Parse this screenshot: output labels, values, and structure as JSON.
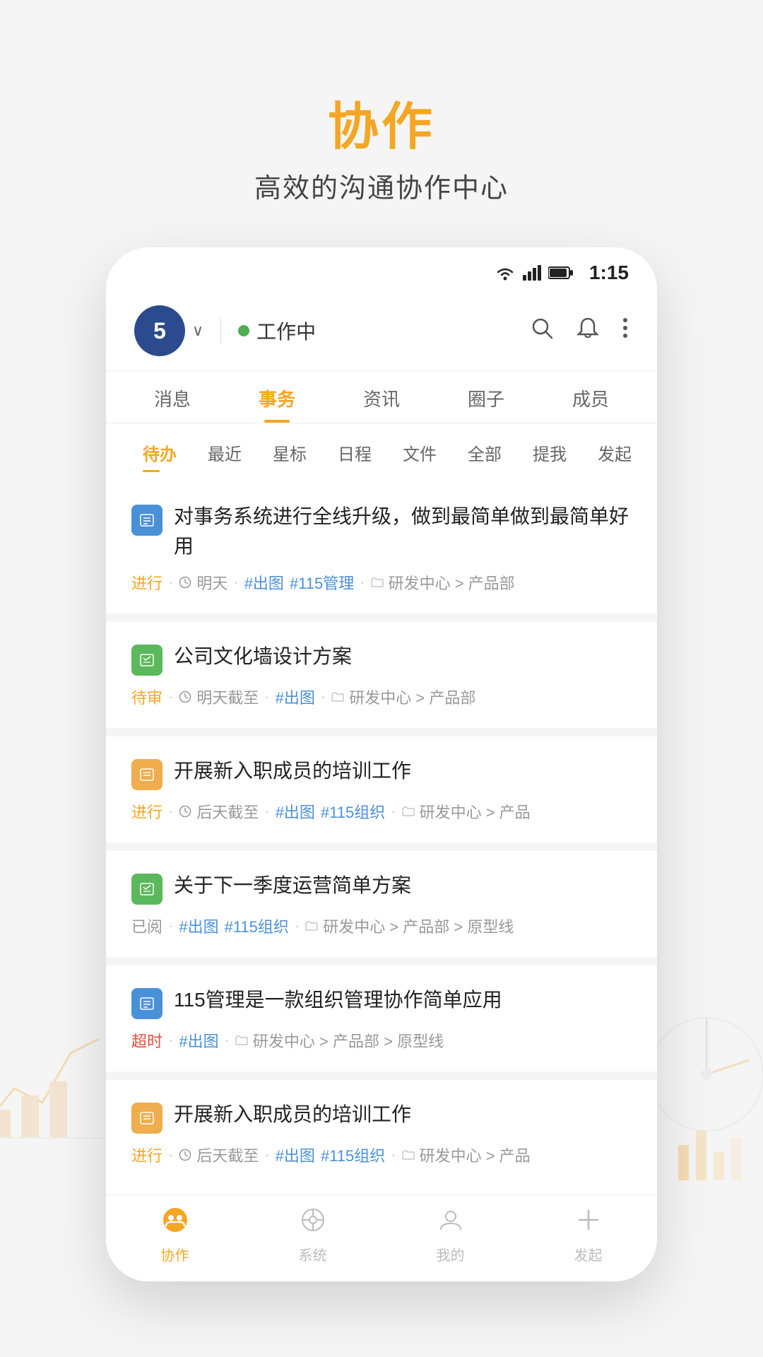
{
  "header": {
    "title": "协作",
    "subtitle": "高效的沟通协作中心"
  },
  "status_bar": {
    "time": "1:15"
  },
  "app_header": {
    "avatar_number": "5",
    "status_label": "工作中",
    "dropdown_char": "∨"
  },
  "nav_tabs": [
    {
      "label": "消息",
      "active": false
    },
    {
      "label": "事务",
      "active": true
    },
    {
      "label": "资讯",
      "active": false
    },
    {
      "label": "圈子",
      "active": false
    },
    {
      "label": "成员",
      "active": false
    }
  ],
  "filter_items": [
    {
      "label": "待办",
      "active": true
    },
    {
      "label": "最近",
      "active": false
    },
    {
      "label": "星标",
      "active": false
    },
    {
      "label": "日程",
      "active": false
    },
    {
      "label": "文件",
      "active": false
    },
    {
      "label": "全部",
      "active": false
    },
    {
      "label": "提我",
      "active": false
    },
    {
      "label": "发起",
      "active": false
    }
  ],
  "tasks": [
    {
      "id": 1,
      "icon_type": "blue",
      "icon_char": "≡",
      "title": "对事务系统进行全线升级，做到最简单做到最简单好用",
      "status": "进行",
      "status_type": "active",
      "deadline": "明天",
      "tags": [
        "#出图",
        "#115管理"
      ],
      "path": "研发中心 > 产品部"
    },
    {
      "id": 2,
      "icon_type": "green",
      "icon_char": "⟳",
      "title": "公司文化墙设计方案",
      "status": "待审",
      "status_type": "pending",
      "deadline": "明天截至",
      "tags": [
        "#出图"
      ],
      "path": "研发中心 > 产品部"
    },
    {
      "id": 3,
      "icon_type": "orange",
      "icon_char": "≡",
      "title": "开展新入职成员的培训工作",
      "status": "进行",
      "status_type": "active",
      "deadline": "后天截至",
      "tags": [
        "#出图",
        "#115组织"
      ],
      "path": "研发中心 > 产品"
    },
    {
      "id": 4,
      "icon_type": "green",
      "icon_char": "≡",
      "title": "关于下一季度运营简单方案",
      "status": "已阅",
      "status_type": "done",
      "deadline": "",
      "tags": [
        "#出图",
        "#115组织"
      ],
      "path": "研发中心 > 产品部 > 原型线"
    },
    {
      "id": 5,
      "icon_type": "blue",
      "icon_char": "≡",
      "title": "115管理是一款组织管理协作简单应用",
      "status": "超时",
      "status_type": "overdue",
      "deadline": "",
      "tags": [
        "#出图"
      ],
      "path": "研发中心 > 产品部 > 原型线"
    },
    {
      "id": 6,
      "icon_type": "orange",
      "icon_char": "≡",
      "title": "开展新入职成员的培训工作",
      "status": "进行",
      "status_type": "active",
      "deadline": "后天截至",
      "tags": [
        "#出图",
        "#115组织"
      ],
      "path": "研发中心 > 产品"
    }
  ],
  "bottom_nav": [
    {
      "label": "协作",
      "active": true,
      "icon": "😊"
    },
    {
      "label": "系统",
      "active": false,
      "icon": "⊕"
    },
    {
      "label": "我的",
      "active": false,
      "icon": "👤"
    },
    {
      "label": "发起",
      "active": false,
      "icon": "+"
    }
  ]
}
